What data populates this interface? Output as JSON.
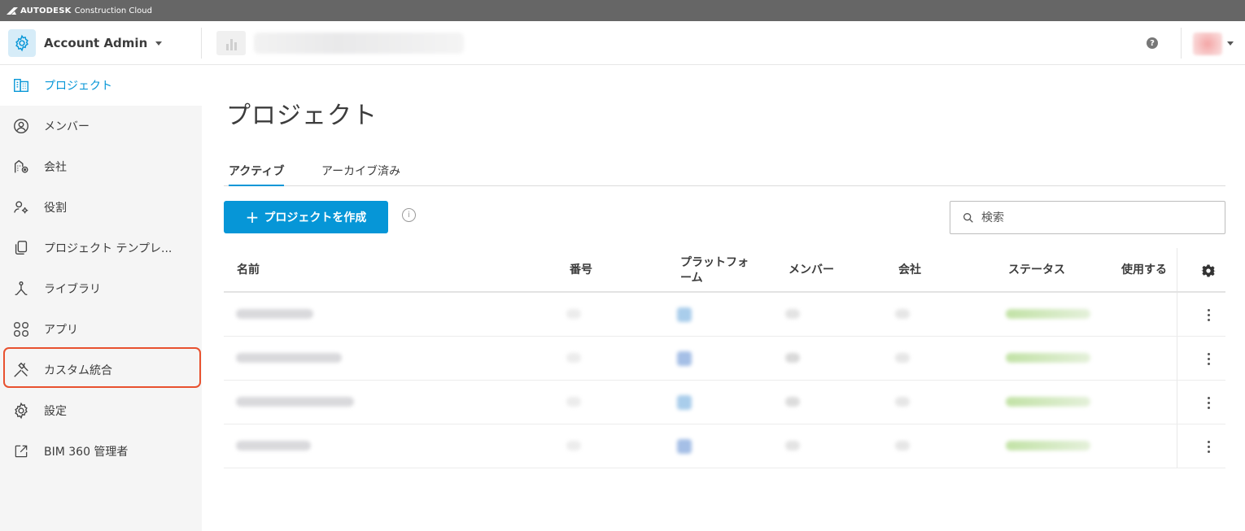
{
  "brand": {
    "strong": "AUTODESK",
    "light": "Construction Cloud"
  },
  "header": {
    "account_label": "Account Admin"
  },
  "sidebar": {
    "items": [
      {
        "label": "プロジェクト",
        "icon": "building-icon"
      },
      {
        "label": "メンバー",
        "icon": "user-circle-icon"
      },
      {
        "label": "会社",
        "icon": "company-icon"
      },
      {
        "label": "役割",
        "icon": "user-gear-icon"
      },
      {
        "label": "プロジェクト テンプレ...",
        "icon": "template-icon"
      },
      {
        "label": "ライブラリ",
        "icon": "library-icon"
      },
      {
        "label": "アプリ",
        "icon": "apps-grid-icon"
      },
      {
        "label": "カスタム統合",
        "icon": "tools-icon"
      },
      {
        "label": "設定",
        "icon": "gear-icon"
      },
      {
        "label": "BIM 360 管理者",
        "icon": "external-link-icon"
      }
    ]
  },
  "main": {
    "title": "プロジェクト",
    "tabs": [
      {
        "label": "アクティブ"
      },
      {
        "label": "アーカイブ済み"
      }
    ],
    "create_button_label": "プロジェクトを作成",
    "search_placeholder": "検索",
    "table": {
      "columns": [
        "名前",
        "番号",
        "プラットフォ\nーム",
        "メンバー",
        "会社",
        "ステータス",
        "使用する"
      ]
    }
  },
  "colors": {
    "accent": "#0696d7",
    "highlight": "#e8512f",
    "brandbar": "#666666"
  }
}
